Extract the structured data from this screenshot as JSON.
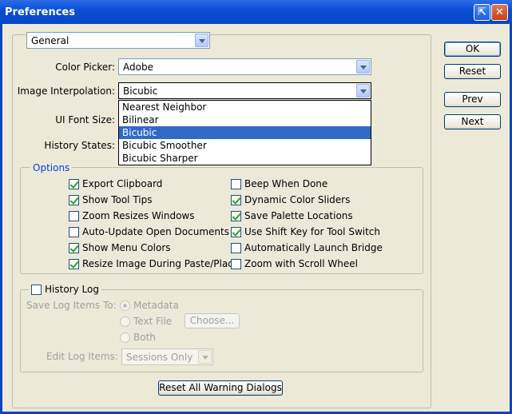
{
  "window": {
    "title": "Preferences",
    "help_glyph": "⇱",
    "close_glyph": "✕"
  },
  "section": {
    "selected": "General"
  },
  "color_picker": {
    "label": "Color Picker:",
    "value": "Adobe"
  },
  "image_interpolation": {
    "label": "Image Interpolation:",
    "value": "Bicubic",
    "options": [
      "Nearest Neighbor",
      "Bilinear",
      "Bicubic",
      "Bicubic Smoother",
      "Bicubic Sharper"
    ],
    "selected_index": 2
  },
  "ui_font_size": {
    "label": "UI Font Size:"
  },
  "history_states": {
    "label": "History States:"
  },
  "options": {
    "legend": "Options",
    "left": [
      {
        "label": "Export Clipboard",
        "checked": true
      },
      {
        "label": "Show Tool Tips",
        "checked": true
      },
      {
        "label": "Zoom Resizes Windows",
        "checked": false
      },
      {
        "label": "Auto-Update Open Documents",
        "checked": false
      },
      {
        "label": "Show Menu Colors",
        "checked": true
      },
      {
        "label": "Resize Image During Paste/Place",
        "checked": true
      }
    ],
    "right": [
      {
        "label": "Beep When Done",
        "checked": false
      },
      {
        "label": "Dynamic Color Sliders",
        "checked": true
      },
      {
        "label": "Save Palette Locations",
        "checked": true
      },
      {
        "label": "Use Shift Key for Tool Switch",
        "checked": true
      },
      {
        "label": "Automatically Launch Bridge",
        "checked": false
      },
      {
        "label": "Zoom with Scroll Wheel",
        "checked": false
      }
    ]
  },
  "history_log": {
    "label": "History Log",
    "checked": false,
    "save_to_label": "Save Log Items To:",
    "radios": [
      {
        "label": "Metadata",
        "selected": true
      },
      {
        "label": "Text File",
        "selected": false
      },
      {
        "label": "Both",
        "selected": false
      }
    ],
    "choose_label": "Choose...",
    "edit_label": "Edit Log Items:",
    "edit_value": "Sessions Only"
  },
  "buttons": {
    "ok": "OK",
    "reset": "Reset",
    "prev": "Prev",
    "next": "Next",
    "reset_warnings": "Reset All Warning Dialogs"
  }
}
